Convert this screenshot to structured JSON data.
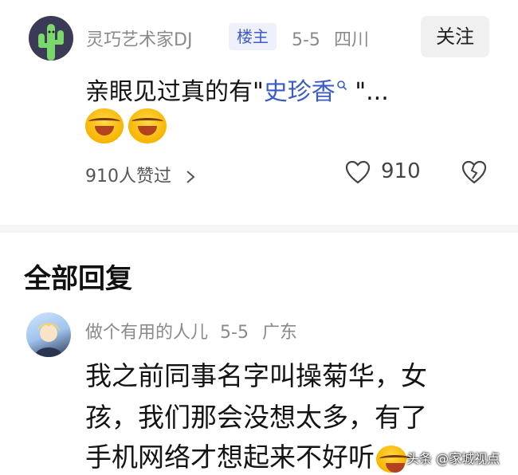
{
  "comment": {
    "author": "灵巧艺术家DJ",
    "badge": "楼主",
    "date": "5-5",
    "location": "四川",
    "follow_label": "关注",
    "text_prefix": "亲眼见过真的有\"",
    "link_text": "史珍香",
    "text_suffix": " \"...",
    "emojis": [
      "laughing-crying-emoji",
      "laughing-crying-emoji"
    ],
    "likes_summary": "910人赞过",
    "like_count": "910"
  },
  "section_title": "全部回复",
  "reply": {
    "author": "做个有用的人儿",
    "date": "5-5",
    "location": "广东",
    "lines": [
      "我之前同事名字叫操菊华，女",
      "孩，我们那会没想太多，有了",
      "手机网络才想起来不好听"
    ]
  },
  "watermark": "头条 @家城视点",
  "colors": {
    "link": "#3b5cc6",
    "badge_bg": "#eef1fb",
    "badge_text": "#3f5bc9",
    "meta": "#8a8a8a"
  }
}
